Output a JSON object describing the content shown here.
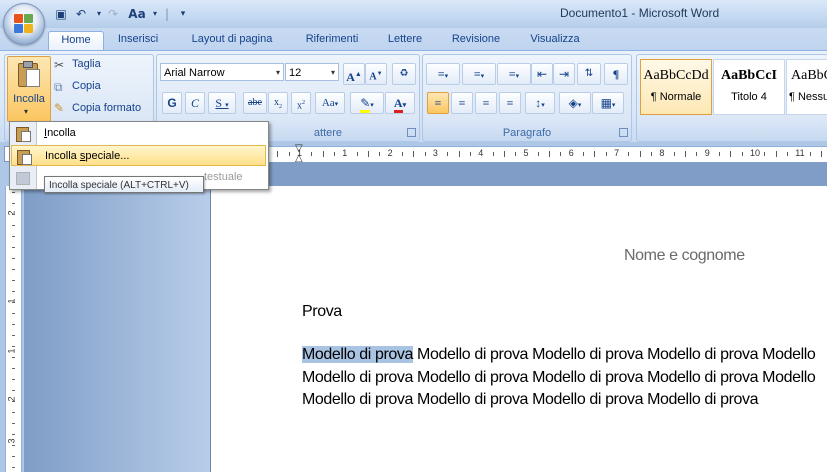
{
  "window": {
    "title": "Documento1 - Microsoft Word"
  },
  "quick_access": {
    "font_size_glyph": "Aa"
  },
  "tabs": [
    "Home",
    "Inserisci",
    "Layout di pagina",
    "Riferimenti",
    "Lettere",
    "Revisione",
    "Visualizza"
  ],
  "clipboard": {
    "paste_label": "Incolla",
    "cut_label": "Taglia",
    "copy_label": "Copia",
    "format_painter_label": "Copia formato"
  },
  "font": {
    "group_label": "Carattere",
    "group_label_visible": "attere",
    "font_name": "Arial Narrow",
    "font_size": "12"
  },
  "paragraph": {
    "group_label": "Paragrafo"
  },
  "styles": [
    {
      "sample": "AaBbCcDd",
      "name": "¶ Normale"
    },
    {
      "sample": "AaBbCcI",
      "name": "Titolo 4"
    },
    {
      "sample": "AaBbCcI",
      "name": "¶ Nessuna"
    }
  ],
  "paste_menu": {
    "items": [
      {
        "label": "Incolla",
        "state": "normal"
      },
      {
        "label": "Incolla speciale...",
        "state": "hover"
      },
      {
        "label": "Incolla come collegamento ipertestuale",
        "visible_fragment": "testuale",
        "state": "disabled"
      }
    ]
  },
  "tooltip": {
    "text": "Incolla speciale (ALT+CTRL+V)"
  },
  "ruler": {
    "numbers": [
      "2",
      "1",
      "1",
      "2",
      "3",
      "4",
      "5",
      "6",
      "7",
      "8",
      "9",
      "10",
      "11",
      "12"
    ]
  },
  "vruler": {
    "numbers": [
      "2",
      "1",
      "1",
      "2",
      "3"
    ]
  },
  "document": {
    "header_text": "Nome e cognome",
    "title": "Prova",
    "highlighted": "Modello di prova",
    "line1_rest": " Modello di prova Modello di prova Modello di prova Modello",
    "line2": "Modello di prova Modello di prova Modello di prova Modello di prova Modello",
    "line3": "Modello di prova Modello di prova Modello di prova Modello di prova"
  },
  "colors": {
    "ribbon": "#dce8f6",
    "accent": "#15428b",
    "highlight": "#a9c3e3",
    "hover": "#ffe08a"
  }
}
